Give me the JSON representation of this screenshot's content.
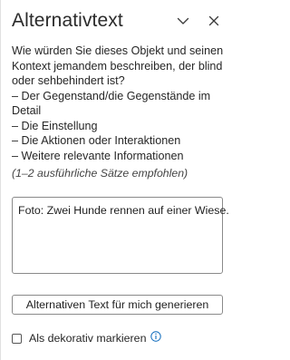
{
  "pane": {
    "title": "Alternativtext",
    "collapse_icon": "chevron-down-icon",
    "close_icon": "close-icon"
  },
  "description": {
    "lines": [
      "Wie würden Sie dieses Objekt und seinen",
      "Kontext jemandem beschreiben, der blind",
      "oder sehbehindert ist?",
      "– Der Gegenstand/die Gegenstände im",
      "Detail",
      "– Die Einstellung",
      "– Die Aktionen oder Interaktionen",
      "– Weitere relevante Informationen"
    ],
    "hint": "(1–2 ausführliche Sätze empfohlen)"
  },
  "alt_text": {
    "value": "Foto: Zwei Hunde rennen auf einer Wiese."
  },
  "generate_button": {
    "label": "Alternativen Text für mich generieren"
  },
  "decorative": {
    "label": "Als dekorativ markieren",
    "checked": false,
    "info_icon": "info-icon"
  },
  "colors": {
    "accent": "#0f6cbd",
    "text": "#262626",
    "border": "#8a8a8a"
  }
}
